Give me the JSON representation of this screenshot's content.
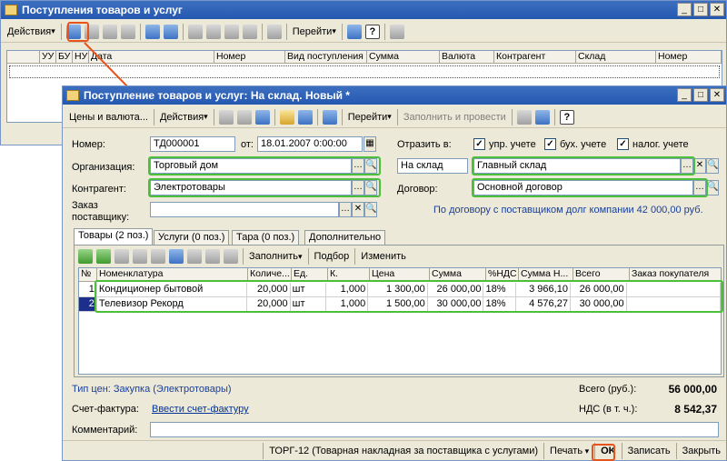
{
  "back_window": {
    "title": "Поступления товаров и услуг",
    "toolbar": {
      "actions_label": "Действия",
      "goto_label": "Перейти"
    },
    "columns": [
      "УУ",
      "БУ",
      "НУ",
      "Дата",
      "Номер",
      "Вид поступления",
      "Сумма",
      "Валюта",
      "Контрагент",
      "Склад",
      "Номер"
    ]
  },
  "doc": {
    "title": "Поступление товаров и услуг: На склад. Новый *",
    "toolbar": {
      "prices_label": "Цены и валюта...",
      "actions_label": "Действия",
      "goto_label": "Перейти",
      "fill_post_label": "Заполнить и провести"
    },
    "number_label": "Номер:",
    "number_value": "ТД000001",
    "date_label": "от:",
    "date_value": "18.01.2007 0:00:00",
    "reflect_label": "Отразить в:",
    "checks": [
      {
        "label": "упр. учете",
        "checked": true
      },
      {
        "label": "бух. учете",
        "checked": true
      },
      {
        "label": "налог. учете",
        "checked": true
      }
    ],
    "org_label": "Организация:",
    "org_value": "Торговый дом",
    "warehouse_type": "На склад",
    "warehouse_value": "Главный склад",
    "contractor_label": "Контрагент:",
    "contractor_value": "Электротовары",
    "contract_label": "Договор:",
    "contract_value": "Основной договор",
    "order_label_1": "Заказ",
    "order_label_2": "поставщику:",
    "debt_info": "По договору с поставщиком долг компании 42 000,00 руб.",
    "tabs": [
      "Товары (2 поз.)",
      "Услуги (0 поз.)",
      "Тара (0 поз.)",
      "Дополнительно"
    ],
    "table_toolbar": {
      "fill_label": "Заполнить",
      "select_label": "Подбор",
      "change_label": "Изменить"
    },
    "table_columns": [
      "№",
      "Номенклатура",
      "Количе...",
      "Ед.",
      "К.",
      "Цена",
      "Сумма",
      "%НДС",
      "Сумма Н...",
      "Всего",
      "Заказ покупателя"
    ],
    "rows": [
      {
        "n": "1",
        "name": "Кондиционер бытовой",
        "qty": "20,000",
        "unit": "шт",
        "k": "1,000",
        "price": "1 300,00",
        "sum": "26 000,00",
        "vat": "18%",
        "vat_sum": "3 966,10",
        "total": "26 000,00",
        "order": ""
      },
      {
        "n": "2",
        "name": "Телевизор Рекорд",
        "qty": "20,000",
        "unit": "шт",
        "k": "1,000",
        "price": "1 500,00",
        "sum": "30 000,00",
        "vat": "18%",
        "vat_sum": "4 576,27",
        "total": "30 000,00",
        "order": ""
      }
    ],
    "price_type": "Тип цен: Закупка (Электротовары)",
    "total_label": "Всего (руб.):",
    "total_value": "56 000,00",
    "invoice_label": "Счет-фактура:",
    "invoice_link": "Ввести счет-фактуру",
    "vat_label": "НДС (в т. ч.):",
    "vat_value": "8 542,37",
    "comment_label": "Комментарий:",
    "comment_value": "",
    "status": {
      "print_form": "ТОРГ-12 (Товарная накладная за поставщика с услугами)",
      "print_label": "Печать",
      "ok_label": "OK",
      "save_label": "Записать",
      "close_label": "Закрыть"
    }
  }
}
